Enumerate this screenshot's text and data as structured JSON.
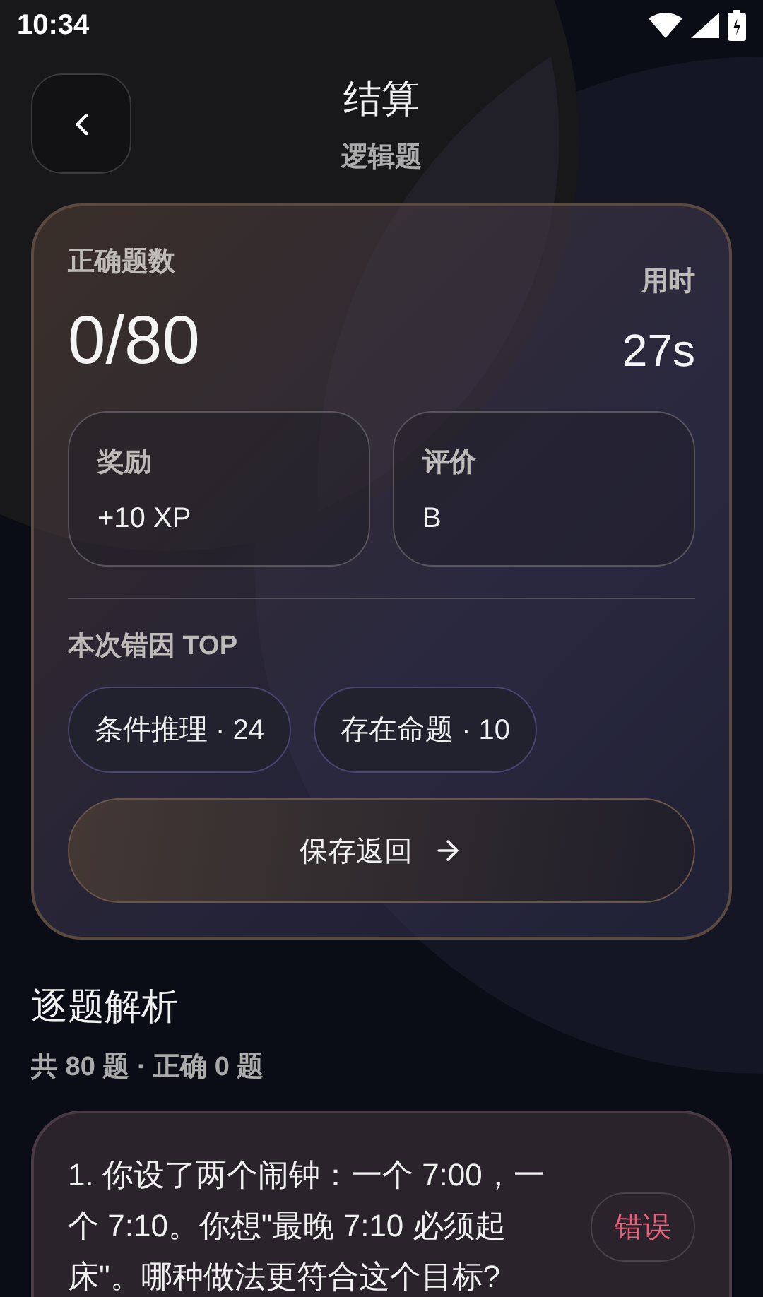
{
  "status_bar": {
    "time": "10:34"
  },
  "header": {
    "title": "结算",
    "subtitle": "逻辑题"
  },
  "summary": {
    "correct_label": "正确题数",
    "correct_value": "0/80",
    "time_label": "用时",
    "time_value": "27s",
    "tiles": [
      {
        "label": "奖励",
        "value": "+10 XP"
      },
      {
        "label": "评价",
        "value": "B"
      }
    ],
    "errors_title": "本次错因 TOP",
    "error_tags": [
      "条件推理 · 24",
      "存在命题 · 10"
    ],
    "save_button": "保存返回"
  },
  "review": {
    "title": "逐题解析",
    "summary": "共 80 题 · 正确 0 题",
    "questions": [
      {
        "text": "1. 你设了两个闹钟：一个 7:00，一个 7:10。你想\"最晚 7:10 必须起床\"。哪种做法更符合这个目标?",
        "result": "错误",
        "correct": false
      }
    ]
  }
}
